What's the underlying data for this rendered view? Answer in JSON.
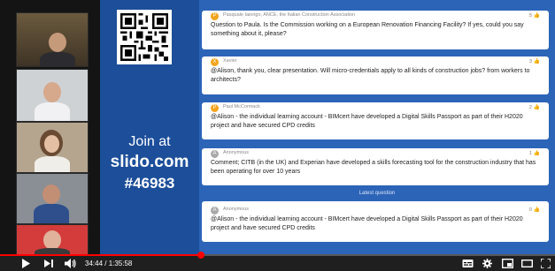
{
  "slido": {
    "join_line1": "Join at",
    "join_line2": "slido.com",
    "join_line3": "#46983"
  },
  "questions": [
    {
      "author": "Pasquale Iaiongo, ANCE, the Italian Construction Association",
      "avatar_letter": "P",
      "avatar_color": "#f3a41c",
      "votes": "5",
      "text": "Question to Paula. Is the Commission working on a European Renovation Financing Facility? If yes, could you say something about it, please?"
    },
    {
      "author": "Xavier",
      "avatar_letter": "X",
      "avatar_color": "#f3a41c",
      "votes": "3",
      "text": "@Alison, thank you, clear presentation. Will micro-credentials apply to all kinds of construction jobs? from workers to architects?"
    },
    {
      "author": "Paul McCormack",
      "avatar_letter": "P",
      "avatar_color": "#f3a41c",
      "votes": "2",
      "text": "@Alison - the individual learning account - BIMcert have developed a Digital Skills Passport as part of their H2020 project and have secured CPD credits"
    },
    {
      "author": "Anonymous",
      "avatar_letter": "A",
      "avatar_color": "#a8a8a8",
      "votes": "1",
      "text": "Comment; CITB (in the UK) and Experian have developed a skills forecasting tool for the construction industry that has been operating for over 10 years"
    }
  ],
  "latest_label": "Latest question",
  "latest": {
    "author": "Anonymous",
    "avatar_letter": "A",
    "avatar_color": "#a8a8a8",
    "votes": "0",
    "text": "@Alison - the individual learning account - BIMcert have developed a Digital Skills Passport as part of their H2020 project and have secured CPD credits"
  },
  "player": {
    "time": "34:44 / 1:35:58",
    "progress_fraction": 0.362,
    "accent": "#ff0000"
  },
  "icons": [
    "play-icon",
    "next-icon",
    "volume-icon",
    "subtitles-icon",
    "settings-icon",
    "miniplayer-icon",
    "theater-icon",
    "fullscreen-icon",
    "qr-code",
    "thumbs-up-icon"
  ]
}
